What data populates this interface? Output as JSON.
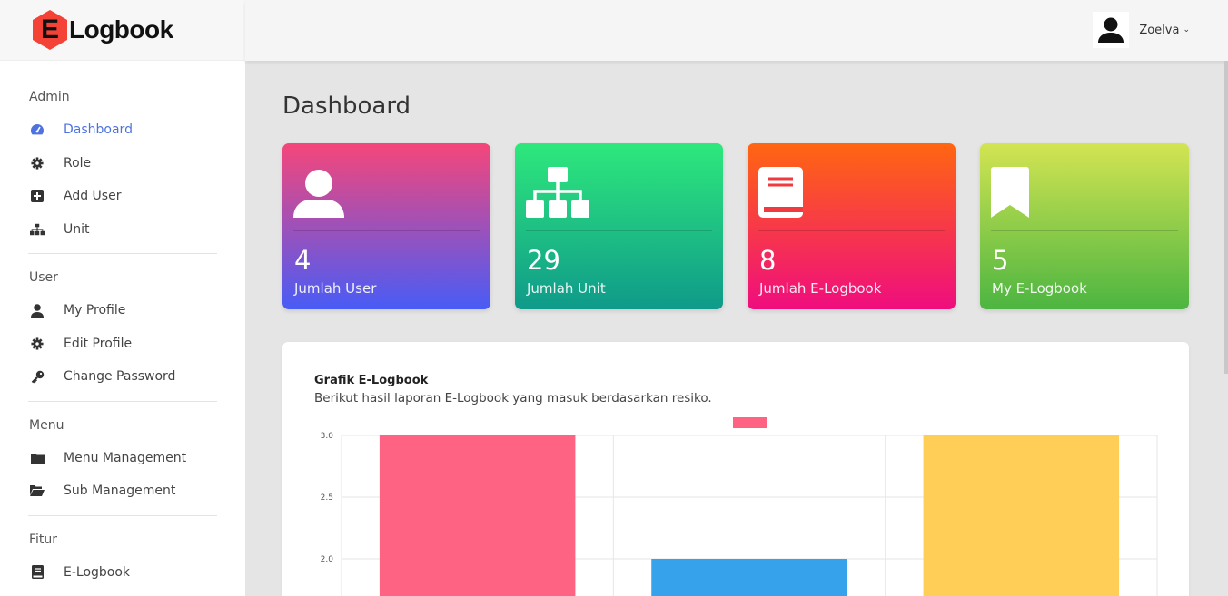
{
  "brand": {
    "letter": "E",
    "name": "Logbook",
    "accent": "#f44336"
  },
  "user": {
    "name": "Zoelva",
    "caret": "⌄"
  },
  "sidebar": {
    "sections": [
      {
        "heading": "Admin",
        "items": [
          {
            "label": "Dashboard",
            "icon": "dashboard-icon",
            "active": true
          },
          {
            "label": "Role",
            "icon": "gear-icon"
          },
          {
            "label": "Add User",
            "icon": "plus-square-icon"
          },
          {
            "label": "Unit",
            "icon": "sitemap-icon"
          }
        ]
      },
      {
        "heading": "User",
        "items": [
          {
            "label": "My Profile",
            "icon": "user-icon"
          },
          {
            "label": "Edit Profile",
            "icon": "gear-icon"
          },
          {
            "label": "Change Password",
            "icon": "key-icon"
          }
        ]
      },
      {
        "heading": "Menu",
        "items": [
          {
            "label": "Menu Management",
            "icon": "folder-icon"
          },
          {
            "label": "Sub Management",
            "icon": "folder-open-icon"
          }
        ]
      },
      {
        "heading": "Fitur",
        "items": [
          {
            "label": "E-Logbook",
            "icon": "book-icon"
          }
        ]
      }
    ]
  },
  "page": {
    "title": "Dashboard"
  },
  "cards": [
    {
      "value": "4",
      "label": "Jumlah User",
      "icon": "user-icon"
    },
    {
      "value": "29",
      "label": "Jumlah Unit",
      "icon": "sitemap-icon"
    },
    {
      "value": "8",
      "label": "Jumlah E-Logbook",
      "icon": "book-icon"
    },
    {
      "value": "5",
      "label": "My E-Logbook",
      "icon": "bookmark-icon"
    }
  ],
  "panel": {
    "title": "Grafik E-Logbook",
    "subtitle": "Berikut hasil laporan E-Logbook yang masuk berdasarkan resiko."
  },
  "chart_data": {
    "type": "bar",
    "categories": [
      "",
      "",
      ""
    ],
    "values": [
      3,
      2,
      3
    ],
    "colors": [
      "#ff6384",
      "#36a2eb",
      "#ffce56"
    ],
    "legend_color": "#ff6384",
    "legend_placement": "top-center",
    "yticks": [
      "3.0",
      "2.5",
      "2.0"
    ],
    "ylim": [
      1.5,
      3.0
    ],
    "grid": true
  }
}
